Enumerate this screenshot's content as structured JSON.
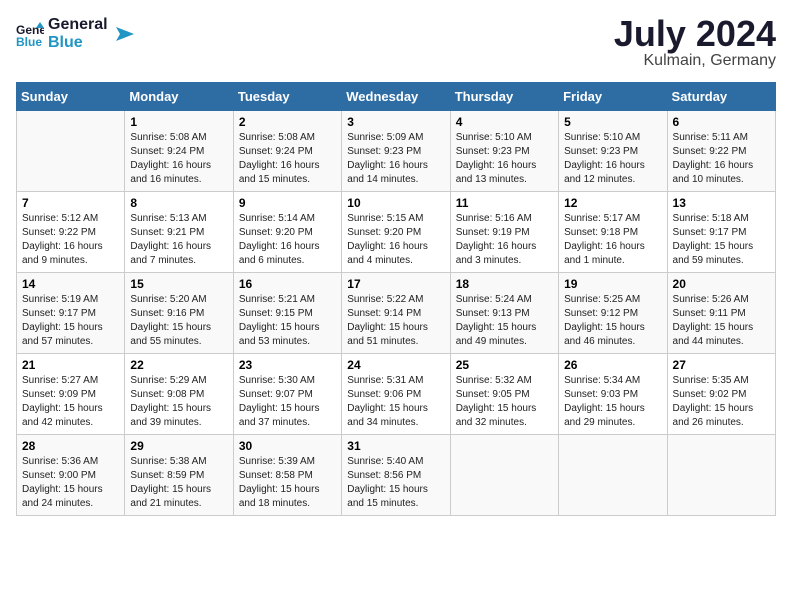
{
  "logo": {
    "line1": "General",
    "line2": "Blue"
  },
  "title": {
    "month_year": "July 2024",
    "location": "Kulmain, Germany"
  },
  "calendar": {
    "headers": [
      "Sunday",
      "Monday",
      "Tuesday",
      "Wednesday",
      "Thursday",
      "Friday",
      "Saturday"
    ],
    "weeks": [
      [
        {
          "day": "",
          "sunrise": "",
          "sunset": "",
          "daylight": ""
        },
        {
          "day": "1",
          "sunrise": "Sunrise: 5:08 AM",
          "sunset": "Sunset: 9:24 PM",
          "daylight": "Daylight: 16 hours and 16 minutes."
        },
        {
          "day": "2",
          "sunrise": "Sunrise: 5:08 AM",
          "sunset": "Sunset: 9:24 PM",
          "daylight": "Daylight: 16 hours and 15 minutes."
        },
        {
          "day": "3",
          "sunrise": "Sunrise: 5:09 AM",
          "sunset": "Sunset: 9:23 PM",
          "daylight": "Daylight: 16 hours and 14 minutes."
        },
        {
          "day": "4",
          "sunrise": "Sunrise: 5:10 AM",
          "sunset": "Sunset: 9:23 PM",
          "daylight": "Daylight: 16 hours and 13 minutes."
        },
        {
          "day": "5",
          "sunrise": "Sunrise: 5:10 AM",
          "sunset": "Sunset: 9:23 PM",
          "daylight": "Daylight: 16 hours and 12 minutes."
        },
        {
          "day": "6",
          "sunrise": "Sunrise: 5:11 AM",
          "sunset": "Sunset: 9:22 PM",
          "daylight": "Daylight: 16 hours and 10 minutes."
        }
      ],
      [
        {
          "day": "7",
          "sunrise": "Sunrise: 5:12 AM",
          "sunset": "Sunset: 9:22 PM",
          "daylight": "Daylight: 16 hours and 9 minutes."
        },
        {
          "day": "8",
          "sunrise": "Sunrise: 5:13 AM",
          "sunset": "Sunset: 9:21 PM",
          "daylight": "Daylight: 16 hours and 7 minutes."
        },
        {
          "day": "9",
          "sunrise": "Sunrise: 5:14 AM",
          "sunset": "Sunset: 9:20 PM",
          "daylight": "Daylight: 16 hours and 6 minutes."
        },
        {
          "day": "10",
          "sunrise": "Sunrise: 5:15 AM",
          "sunset": "Sunset: 9:20 PM",
          "daylight": "Daylight: 16 hours and 4 minutes."
        },
        {
          "day": "11",
          "sunrise": "Sunrise: 5:16 AM",
          "sunset": "Sunset: 9:19 PM",
          "daylight": "Daylight: 16 hours and 3 minutes."
        },
        {
          "day": "12",
          "sunrise": "Sunrise: 5:17 AM",
          "sunset": "Sunset: 9:18 PM",
          "daylight": "Daylight: 16 hours and 1 minute."
        },
        {
          "day": "13",
          "sunrise": "Sunrise: 5:18 AM",
          "sunset": "Sunset: 9:17 PM",
          "daylight": "Daylight: 15 hours and 59 minutes."
        }
      ],
      [
        {
          "day": "14",
          "sunrise": "Sunrise: 5:19 AM",
          "sunset": "Sunset: 9:17 PM",
          "daylight": "Daylight: 15 hours and 57 minutes."
        },
        {
          "day": "15",
          "sunrise": "Sunrise: 5:20 AM",
          "sunset": "Sunset: 9:16 PM",
          "daylight": "Daylight: 15 hours and 55 minutes."
        },
        {
          "day": "16",
          "sunrise": "Sunrise: 5:21 AM",
          "sunset": "Sunset: 9:15 PM",
          "daylight": "Daylight: 15 hours and 53 minutes."
        },
        {
          "day": "17",
          "sunrise": "Sunrise: 5:22 AM",
          "sunset": "Sunset: 9:14 PM",
          "daylight": "Daylight: 15 hours and 51 minutes."
        },
        {
          "day": "18",
          "sunrise": "Sunrise: 5:24 AM",
          "sunset": "Sunset: 9:13 PM",
          "daylight": "Daylight: 15 hours and 49 minutes."
        },
        {
          "day": "19",
          "sunrise": "Sunrise: 5:25 AM",
          "sunset": "Sunset: 9:12 PM",
          "daylight": "Daylight: 15 hours and 46 minutes."
        },
        {
          "day": "20",
          "sunrise": "Sunrise: 5:26 AM",
          "sunset": "Sunset: 9:11 PM",
          "daylight": "Daylight: 15 hours and 44 minutes."
        }
      ],
      [
        {
          "day": "21",
          "sunrise": "Sunrise: 5:27 AM",
          "sunset": "Sunset: 9:09 PM",
          "daylight": "Daylight: 15 hours and 42 minutes."
        },
        {
          "day": "22",
          "sunrise": "Sunrise: 5:29 AM",
          "sunset": "Sunset: 9:08 PM",
          "daylight": "Daylight: 15 hours and 39 minutes."
        },
        {
          "day": "23",
          "sunrise": "Sunrise: 5:30 AM",
          "sunset": "Sunset: 9:07 PM",
          "daylight": "Daylight: 15 hours and 37 minutes."
        },
        {
          "day": "24",
          "sunrise": "Sunrise: 5:31 AM",
          "sunset": "Sunset: 9:06 PM",
          "daylight": "Daylight: 15 hours and 34 minutes."
        },
        {
          "day": "25",
          "sunrise": "Sunrise: 5:32 AM",
          "sunset": "Sunset: 9:05 PM",
          "daylight": "Daylight: 15 hours and 32 minutes."
        },
        {
          "day": "26",
          "sunrise": "Sunrise: 5:34 AM",
          "sunset": "Sunset: 9:03 PM",
          "daylight": "Daylight: 15 hours and 29 minutes."
        },
        {
          "day": "27",
          "sunrise": "Sunrise: 5:35 AM",
          "sunset": "Sunset: 9:02 PM",
          "daylight": "Daylight: 15 hours and 26 minutes."
        }
      ],
      [
        {
          "day": "28",
          "sunrise": "Sunrise: 5:36 AM",
          "sunset": "Sunset: 9:00 PM",
          "daylight": "Daylight: 15 hours and 24 minutes."
        },
        {
          "day": "29",
          "sunrise": "Sunrise: 5:38 AM",
          "sunset": "Sunset: 8:59 PM",
          "daylight": "Daylight: 15 hours and 21 minutes."
        },
        {
          "day": "30",
          "sunrise": "Sunrise: 5:39 AM",
          "sunset": "Sunset: 8:58 PM",
          "daylight": "Daylight: 15 hours and 18 minutes."
        },
        {
          "day": "31",
          "sunrise": "Sunrise: 5:40 AM",
          "sunset": "Sunset: 8:56 PM",
          "daylight": "Daylight: 15 hours and 15 minutes."
        },
        {
          "day": "",
          "sunrise": "",
          "sunset": "",
          "daylight": ""
        },
        {
          "day": "",
          "sunrise": "",
          "sunset": "",
          "daylight": ""
        },
        {
          "day": "",
          "sunrise": "",
          "sunset": "",
          "daylight": ""
        }
      ]
    ]
  }
}
